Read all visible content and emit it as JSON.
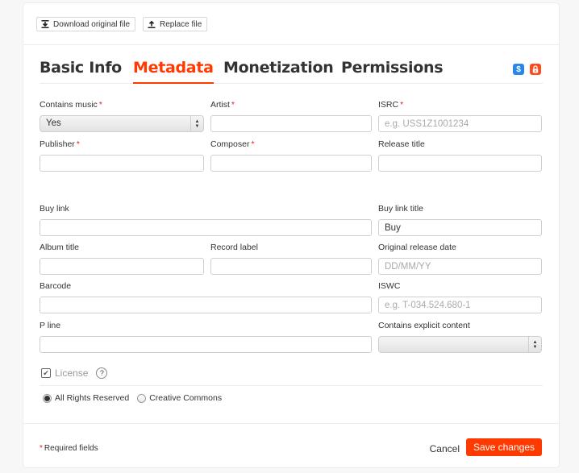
{
  "toolbar": {
    "download_label": "Download original file",
    "replace_label": "Replace file"
  },
  "tabs": [
    {
      "label": "Basic Info",
      "active": false
    },
    {
      "label": "Metadata",
      "active": true
    },
    {
      "label": "Monetization",
      "active": false
    },
    {
      "label": "Permissions",
      "active": false
    }
  ],
  "badges": {
    "monetization": {
      "glyph": "$",
      "color": "#2a87e5"
    },
    "private": {
      "glyph": "lock",
      "color": "#ff4a1c"
    }
  },
  "form": {
    "contains_music": {
      "label": "Contains music",
      "required": "*",
      "value": "Yes"
    },
    "artist": {
      "label": "Artist",
      "required": "*",
      "value": ""
    },
    "isrc": {
      "label": "ISRC",
      "required": "*",
      "placeholder": "e.g. USS1Z1001234"
    },
    "publisher": {
      "label": "Publisher",
      "required": "*",
      "value": ""
    },
    "composer": {
      "label": "Composer",
      "required": "*",
      "value": ""
    },
    "release_title": {
      "label": "Release title",
      "value": ""
    },
    "buy_link": {
      "label": "Buy link",
      "value": ""
    },
    "buy_link_title": {
      "label": "Buy link title",
      "value": "Buy"
    },
    "album_title": {
      "label": "Album title",
      "value": ""
    },
    "record_label": {
      "label": "Record label",
      "value": ""
    },
    "original_release_date": {
      "label": "Original release date",
      "placeholder": "DD/MM/YY"
    },
    "barcode": {
      "label": "Barcode",
      "value": ""
    },
    "iswc": {
      "label": "ISWC",
      "placeholder": "e.g. T-034.524.680-1"
    },
    "p_line": {
      "label": "P line",
      "value": ""
    },
    "explicit": {
      "label": "Contains explicit content",
      "value": ""
    }
  },
  "license": {
    "label": "License",
    "checked": true,
    "help": "?",
    "options": [
      {
        "label": "All Rights Reserved",
        "selected": true
      },
      {
        "label": "Creative Commons",
        "selected": false
      }
    ]
  },
  "footer": {
    "required_note_star": "*",
    "required_note": "Required fields",
    "cancel_label": "Cancel",
    "save_label": "Save changes"
  },
  "colors": {
    "accent": "#ff3a00",
    "required": "#e0231b",
    "blue_badge": "#2a87e5"
  }
}
